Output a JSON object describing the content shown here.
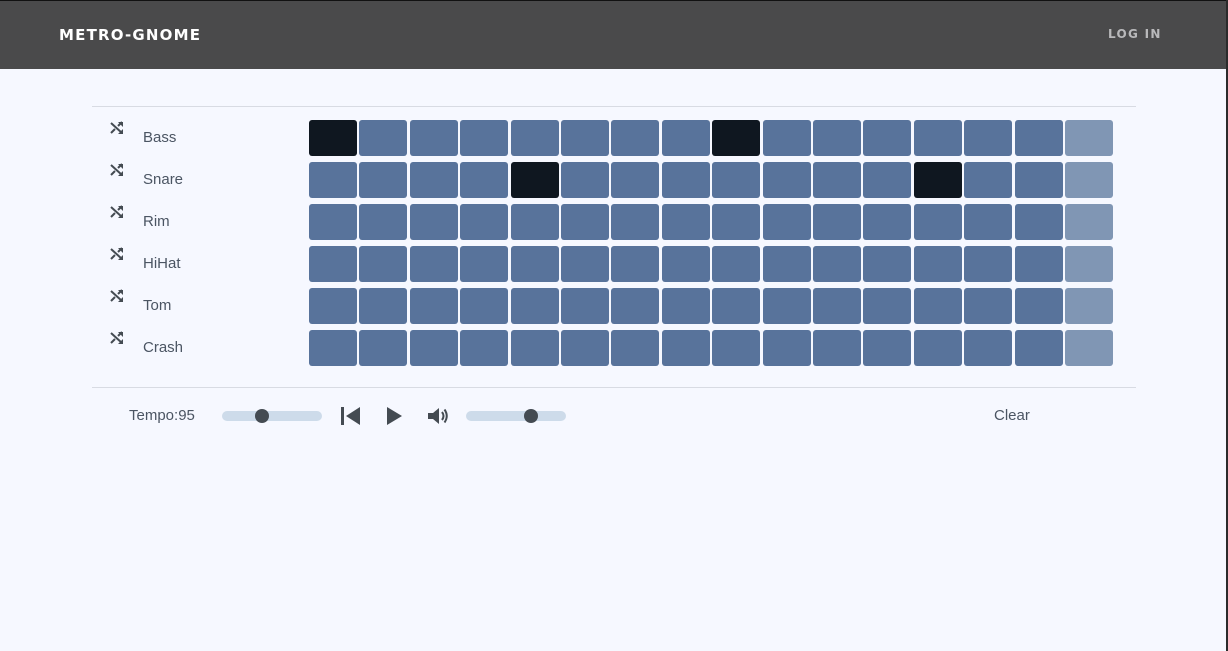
{
  "header": {
    "brand": "METRO-GNOME",
    "login_label": "LOG IN"
  },
  "tracks": [
    {
      "name": "Bass",
      "steps": [
        1,
        0,
        0,
        0,
        0,
        0,
        0,
        0,
        1,
        0,
        0,
        0,
        0,
        0,
        0,
        0
      ]
    },
    {
      "name": "Snare",
      "steps": [
        0,
        0,
        0,
        0,
        1,
        0,
        0,
        0,
        0,
        0,
        0,
        0,
        1,
        0,
        0,
        0
      ]
    },
    {
      "name": "Rim",
      "steps": [
        0,
        0,
        0,
        0,
        0,
        0,
        0,
        0,
        0,
        0,
        0,
        0,
        0,
        0,
        0,
        0
      ]
    },
    {
      "name": "HiHat",
      "steps": [
        0,
        0,
        0,
        0,
        0,
        0,
        0,
        0,
        0,
        0,
        0,
        0,
        0,
        0,
        0,
        0
      ]
    },
    {
      "name": "Tom",
      "steps": [
        0,
        0,
        0,
        0,
        0,
        0,
        0,
        0,
        0,
        0,
        0,
        0,
        0,
        0,
        0,
        0
      ]
    },
    {
      "name": "Crash",
      "steps": [
        0,
        0,
        0,
        0,
        0,
        0,
        0,
        0,
        0,
        0,
        0,
        0,
        0,
        0,
        0,
        0
      ]
    }
  ],
  "current_step": 15,
  "controls": {
    "tempo_label": "Tempo:95",
    "tempo_slider_fraction": 0.4,
    "volume_slider_fraction": 0.65,
    "clear_label": "Clear"
  },
  "colors": {
    "step_off": "#58739b",
    "step_on": "#0f1720",
    "step_current": "#8096b4",
    "navbar": "#4a4a4b",
    "background": "#f6f8ff"
  },
  "icons": {
    "shuffle": "shuffle-icon",
    "skip_back": "skip-back-icon",
    "play": "play-icon",
    "volume": "volume-icon"
  }
}
